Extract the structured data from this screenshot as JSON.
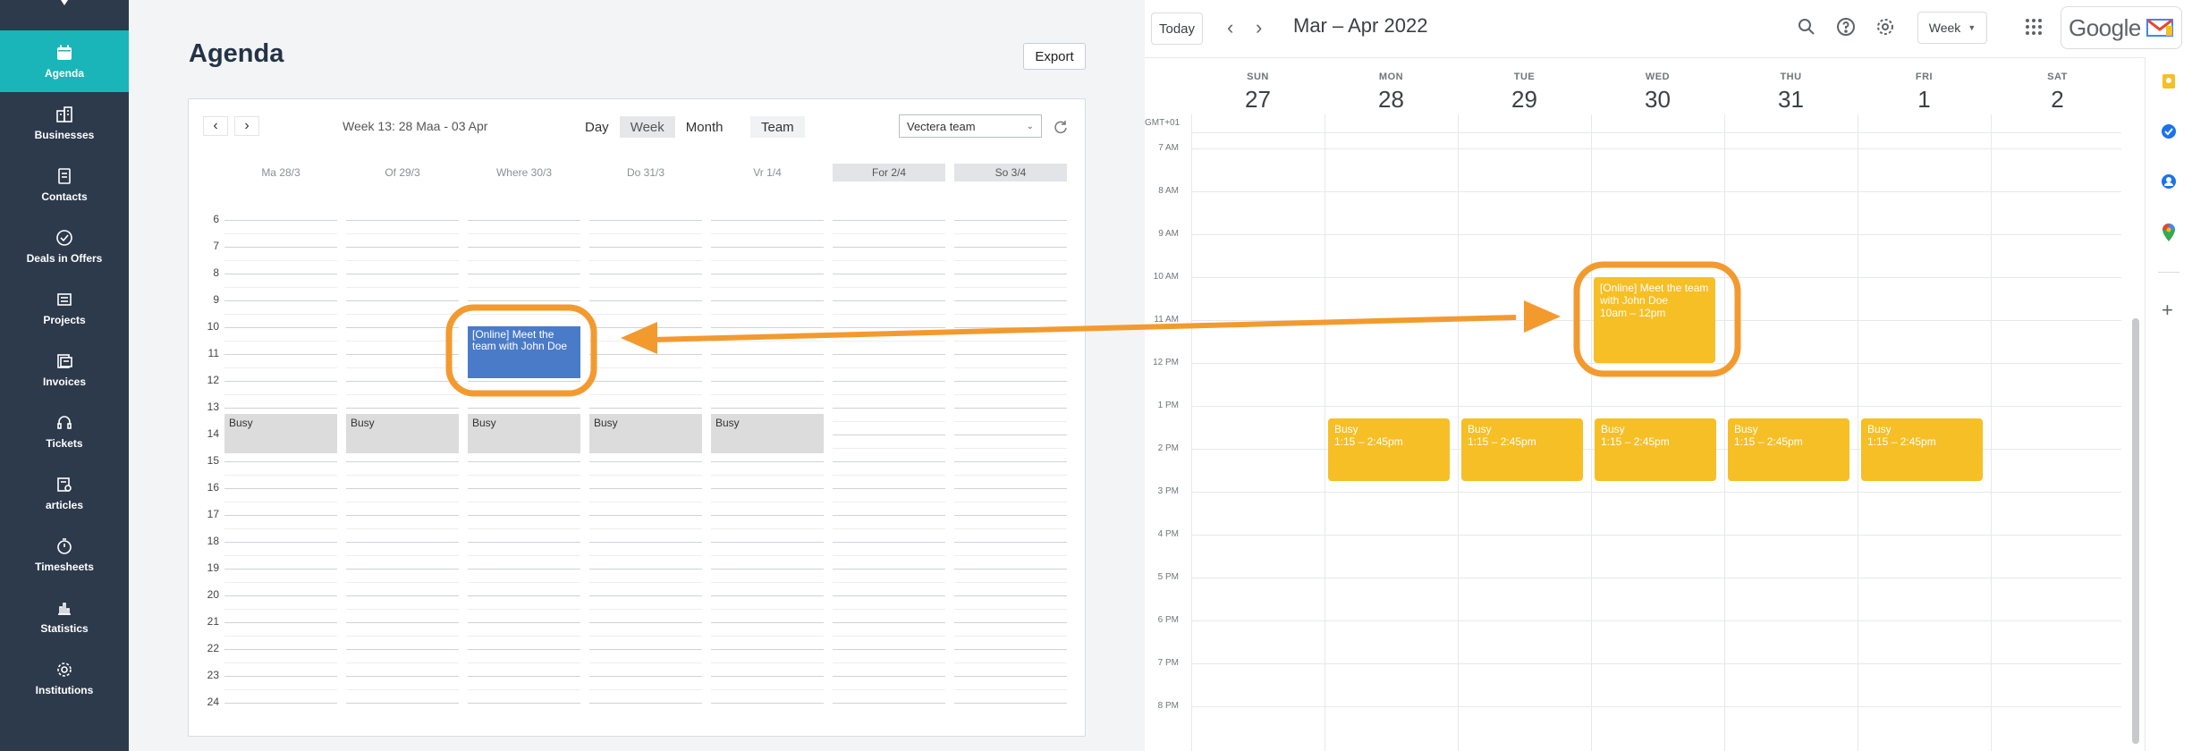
{
  "sidebar": {
    "items": [
      {
        "label": "Agenda",
        "icon": "calendar-icon",
        "active": true
      },
      {
        "label": "Businesses",
        "icon": "businesses-icon",
        "active": false
      },
      {
        "label": "Contacts",
        "icon": "contacts-icon",
        "active": false
      },
      {
        "label": "Deals in Offers",
        "icon": "check-circle-icon",
        "active": false
      },
      {
        "label": "Projects",
        "icon": "projects-icon",
        "active": false
      },
      {
        "label": "Invoices",
        "icon": "invoices-icon",
        "active": false
      },
      {
        "label": "Tickets",
        "icon": "headset-icon",
        "active": false
      },
      {
        "label": "articles",
        "icon": "articles-icon",
        "active": false
      },
      {
        "label": "Timesheets",
        "icon": "stopwatch-icon",
        "active": false
      },
      {
        "label": "Statistics",
        "icon": "bar-chart-icon",
        "active": false
      },
      {
        "label": "Institutions",
        "icon": "gear-icon",
        "active": false
      }
    ]
  },
  "agenda": {
    "title": "Agenda",
    "export_label": "Export",
    "week_label": "Week 13: 28 Maa - 03 Apr",
    "views": [
      "Day",
      "Week",
      "Month"
    ],
    "active_view": "Week",
    "team_label": "Team",
    "team_select": "Vectera team",
    "days": [
      "Ma 28/3",
      "Of 29/3",
      "Where 30/3",
      "Do 31/3",
      "Vr 1/4",
      "For 2/4",
      "So 3/4"
    ],
    "hours": [
      "6",
      "7",
      "8",
      "9",
      "10",
      "11",
      "12",
      "13",
      "14",
      "15",
      "16",
      "17",
      "18",
      "19",
      "20",
      "21",
      "22",
      "23",
      "24"
    ],
    "busy_label": "Busy",
    "event": "[Online] Meet the team with John Doe"
  },
  "gcal": {
    "today_label": "Today",
    "title": "Mar – Apr 2022",
    "view_select": "Week",
    "logo_text": "Google",
    "timezone": "GMT+01",
    "days": [
      {
        "name": "SUN",
        "num": "27"
      },
      {
        "name": "MON",
        "num": "28"
      },
      {
        "name": "TUE",
        "num": "29"
      },
      {
        "name": "WED",
        "num": "30"
      },
      {
        "name": "THU",
        "num": "31"
      },
      {
        "name": "FRI",
        "num": "1"
      },
      {
        "name": "SAT",
        "num": "2"
      }
    ],
    "times": [
      "7 AM",
      "8 AM",
      "9 AM",
      "10 AM",
      "11 AM",
      "12 PM",
      "1 PM",
      "2 PM",
      "3 PM",
      "4 PM",
      "5 PM",
      "6 PM",
      "7 PM",
      "8 PM"
    ],
    "event": {
      "title": "[Online] Meet the team with John Doe",
      "time": "10am – 12pm"
    },
    "busy": {
      "title": "Busy",
      "time": "1:15 – 2:45pm"
    }
  },
  "colors": {
    "sidebar_bg": "#2d3a4c",
    "sidebar_active": "#1ab5b8",
    "agenda_event": "#4a7bc8",
    "gcal_event": "#f6bf26",
    "highlight": "#f39a2f"
  }
}
